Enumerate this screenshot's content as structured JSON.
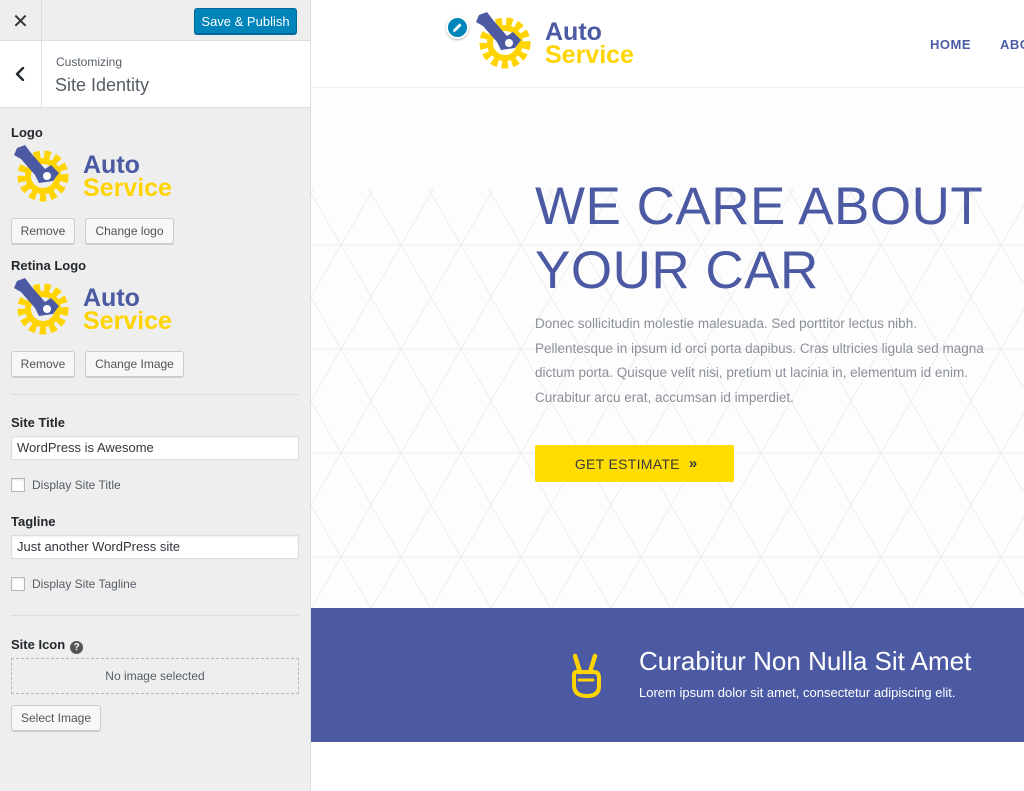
{
  "customizer": {
    "close_icon": "close-icon",
    "publish_label": "Save & Publish",
    "breadcrumb": "Customizing",
    "section_title": "Site Identity",
    "logo_label": "Logo",
    "logo_remove": "Remove",
    "logo_change": "Change logo",
    "retina_label": "Retina Logo",
    "retina_remove": "Remove",
    "retina_change": "Change Image",
    "site_title_label": "Site Title",
    "site_title_value": "WordPress is Awesome",
    "display_title_label": "Display Site Title",
    "display_title_checked": false,
    "tagline_label": "Tagline",
    "tagline_value": "Just another WordPress site",
    "display_tagline_label": "Display Site Tagline",
    "display_tagline_checked": false,
    "site_icon_label": "Site Icon",
    "help_glyph": "?",
    "no_image": "No image selected",
    "select_image": "Select Image",
    "accent_color": "#0085ba"
  },
  "logo": {
    "line1": "Auto",
    "line2": "Service",
    "primary_color": "#4b5aa3",
    "secondary_color": "#ffd400"
  },
  "site": {
    "nav": [
      "HOME",
      "ABO"
    ],
    "hero_line1": "WE CARE ABOUT",
    "hero_line2": "YOUR CAR",
    "hero_text": "Donec sollicitudin molestie malesuada. Sed porttitor lectus nibh. Pellentesque in ipsum id orci porta dapibus. Cras ultricies ligula sed magna dictum porta. Quisque velit nisi, pretium ut lacinia in, elementum id enim. Curabitur arcu erat, accumsan id imperdiet.",
    "cta_label": "GET ESTIMATE",
    "cta_arrows": "»",
    "band_title": "Curabitur Non Nulla Sit Amet",
    "band_text": "Lorem ipsum dolor sit amet, consectetur adipiscing elit.",
    "band_icon": "victory-hand-icon",
    "band_color": "#4b5aa3",
    "cta_color": "#ffdd00"
  }
}
